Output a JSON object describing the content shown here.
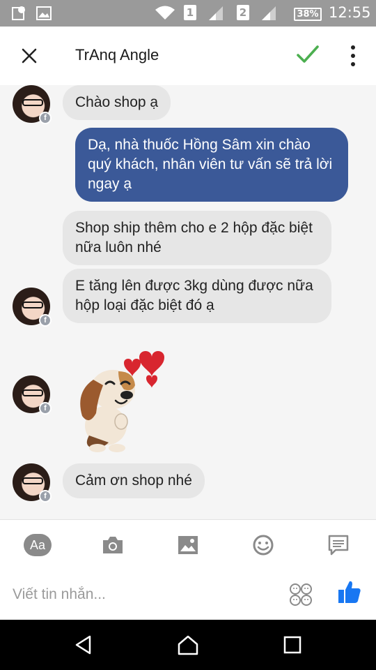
{
  "status_bar": {
    "sim1": "1",
    "sim2": "2",
    "battery": "38%",
    "time": "12:55"
  },
  "header": {
    "contact_name": "TrAnq Angle"
  },
  "messages": [
    {
      "sender": "them",
      "text": "Chào shop ạ"
    },
    {
      "sender": "me",
      "text": "Dạ, nhà thuốc Hồng Sâm xin chào quý khách,  nhân viên tư vấn sẽ trả lời ngay ạ"
    },
    {
      "sender": "them",
      "text": "Shop ship thêm cho e 2 hộp đặc biệt nữa luôn nhé"
    },
    {
      "sender": "them",
      "text": "E tăng lên được 3kg dùng được nữa hộp loại đặc biệt đó ạ"
    },
    {
      "sender": "them",
      "type": "sticker",
      "icon": "puppy-heart-sticker"
    },
    {
      "sender": "them",
      "text": "Cảm ơn shop nhé"
    }
  ],
  "toolbar": {
    "text_button_label": "Aa",
    "icons": [
      "camera-icon",
      "gallery-icon",
      "emoji-icon",
      "quick-reply-icon"
    ]
  },
  "composer": {
    "placeholder": "Viết tin nhắn...",
    "icons": [
      "sticker-faces-icon",
      "like-thumb-icon"
    ]
  },
  "colors": {
    "my_bubble": "#3b5998",
    "their_bubble": "#e6e6e6",
    "check": "#4caf50",
    "like": "#1877f2"
  }
}
